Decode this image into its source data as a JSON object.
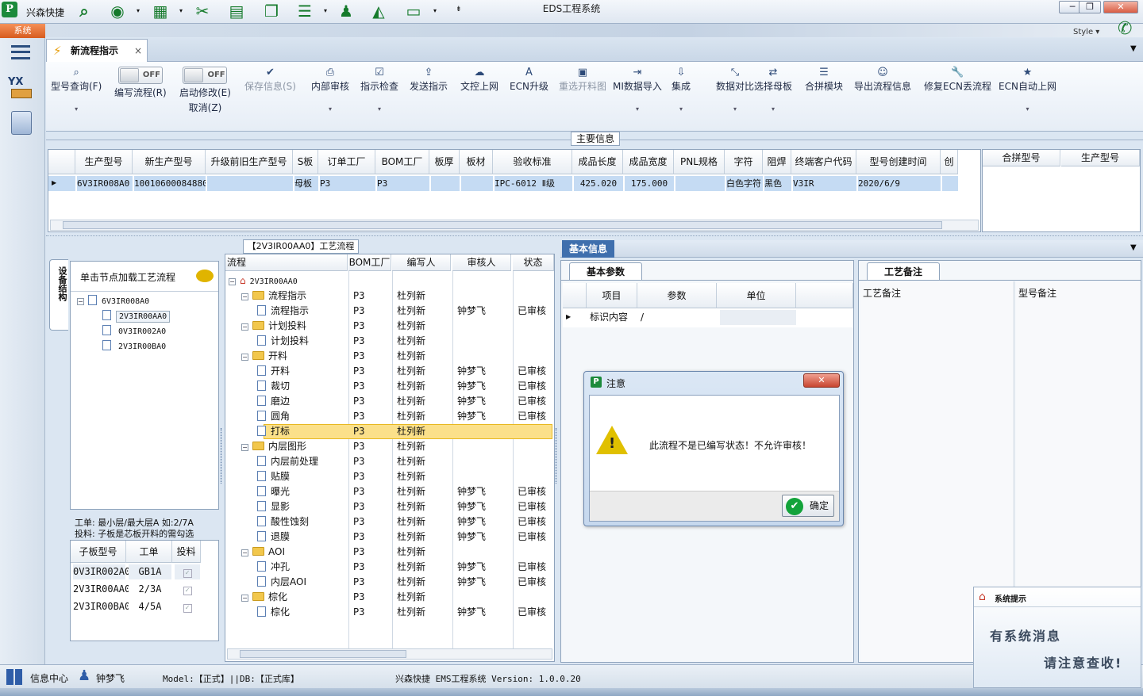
{
  "window": {
    "app_name": "兴森快捷",
    "title": "EDS工程系统",
    "minimize": "─",
    "restore": "❐",
    "close": "✕",
    "style_label": "Style"
  },
  "system_menu": "系统",
  "rail_icons": [
    "menu-icon",
    "yx-factory-icon",
    "calculator-icon"
  ],
  "rail_text": "YX",
  "tab": {
    "label": "新流程指示",
    "close": "×"
  },
  "ribbon": [
    {
      "label": "型号查询(F)",
      "icon": "search-icon",
      "glyph": "⌕",
      "dropdown": true
    },
    {
      "label": "编写流程(R)",
      "toggle": "OFF"
    },
    {
      "label": "启动修改(E)",
      "sub": "取消(Z)",
      "toggle": "OFF"
    },
    {
      "label": "保存信息(S)",
      "icon": "check-icon",
      "glyph": "✔",
      "disabled": true
    },
    {
      "label": "内部审核",
      "icon": "print-icon",
      "glyph": "⎙",
      "dropdown": true
    },
    {
      "label": "指示检查",
      "icon": "checkbox-icon",
      "glyph": "☑",
      "dropdown": true
    },
    {
      "label": "发送指示",
      "icon": "upload-icon",
      "glyph": "⇪"
    },
    {
      "label": "文控上网",
      "icon": "cloud-upload-icon",
      "glyph": "☁"
    },
    {
      "label": "ECN升级",
      "icon": "font-icon",
      "glyph": "A"
    },
    {
      "label": "重选开料图",
      "icon": "picture-icon",
      "glyph": "▣",
      "disabled": true
    },
    {
      "label": "MI数据导入",
      "icon": "import-icon",
      "glyph": "⇥",
      "dropdown": true
    },
    {
      "label": "集成",
      "icon": "download-icon",
      "glyph": "⇩",
      "dropdown": true
    },
    {
      "label": "数据对比",
      "icon": "compress-icon",
      "glyph": "⤡",
      "dropdown": true
    },
    {
      "label": "选择母板",
      "icon": "shuffle-icon",
      "glyph": "⇄",
      "dropdown": true
    },
    {
      "label": "合拼模块",
      "icon": "list-icon",
      "glyph": "☰"
    },
    {
      "label": "导出流程信息",
      "icon": "smile-icon",
      "glyph": "☺"
    },
    {
      "label": "修复ECN丢流程",
      "icon": "wrench-icon",
      "glyph": "🔧"
    },
    {
      "label": "ECN自动上网",
      "icon": "star-icon",
      "glyph": "★",
      "dropdown": true
    }
  ],
  "main_info": {
    "title": "主要信息",
    "columns": [
      "生产型号",
      "新生产型号",
      "升级前旧生产型号",
      "S板",
      "订单工厂",
      "BOM工厂",
      "板厚",
      "板材",
      "验收标准",
      "成品长度",
      "成品宽度",
      "PNL规格",
      "字符",
      "阻焊",
      "终端客户代码",
      "型号创建时间",
      "创"
    ],
    "row": [
      "6V3IR008A0",
      "10010600084880",
      "",
      "母板",
      "P3",
      "P3",
      "",
      "",
      "IPC-6012 Ⅱ级",
      "425.020",
      "175.000",
      "",
      "白色字符",
      "黑色",
      "V3IR",
      "2020/6/9",
      ""
    ],
    "side_columns": [
      "合拼型号",
      "生产型号"
    ]
  },
  "left_panel": {
    "vertical_tab": "设备结构",
    "hint": "单击节点加载工艺流程",
    "tree": {
      "root": "6V3IR008A0",
      "children": [
        "2V3IR00AA0",
        "0V3IR002A0",
        "2V3IR00BA0"
      ],
      "selected": "2V3IR00AA0"
    },
    "note_line1": "工单: 最小层/最大层A 如:2/7A",
    "note_line2": "投料: 子板是芯板开料的需勾选",
    "sub_table": {
      "columns": [
        "子板型号",
        "工单",
        "投料"
      ],
      "rows": [
        [
          "0V3IR002A0",
          "GB1A",
          true
        ],
        [
          "2V3IR00AA0",
          "2/3A",
          true
        ],
        [
          "2V3IR00BA0",
          "4/5A",
          true
        ]
      ]
    }
  },
  "flow_panel": {
    "title": "【2V3IR00AA0】工艺流程",
    "columns": [
      "流程",
      "BOM工厂",
      "编写人",
      "审核人",
      "状态"
    ],
    "root": "2V3IR00AA0",
    "rows": [
      {
        "name": "流程指示",
        "level": 1,
        "bom": "P3",
        "writer": "杜列新",
        "reviewer": "",
        "status": ""
      },
      {
        "name": "流程指示",
        "level": 2,
        "bom": "P3",
        "writer": "杜列新",
        "reviewer": "钟梦飞",
        "status": "已审核"
      },
      {
        "name": "计划投料",
        "level": 1,
        "bom": "P3",
        "writer": "杜列新",
        "reviewer": "",
        "status": ""
      },
      {
        "name": "计划投料",
        "level": 2,
        "bom": "P3",
        "writer": "杜列新",
        "reviewer": "",
        "status": ""
      },
      {
        "name": "开料",
        "level": 1,
        "bom": "P3",
        "writer": "杜列新",
        "reviewer": "",
        "status": ""
      },
      {
        "name": "开料",
        "level": 2,
        "bom": "P3",
        "writer": "杜列新",
        "reviewer": "钟梦飞",
        "status": "已审核"
      },
      {
        "name": "裁切",
        "level": 2,
        "bom": "P3",
        "writer": "杜列新",
        "reviewer": "钟梦飞",
        "status": "已审核"
      },
      {
        "name": "磨边",
        "level": 2,
        "bom": "P3",
        "writer": "杜列新",
        "reviewer": "钟梦飞",
        "status": "已审核"
      },
      {
        "name": "圆角",
        "level": 2,
        "bom": "P3",
        "writer": "杜列新",
        "reviewer": "钟梦飞",
        "status": "已审核"
      },
      {
        "name": "打标",
        "level": 2,
        "bom": "P3",
        "writer": "杜列新",
        "reviewer": "",
        "status": "",
        "selected": true
      },
      {
        "name": "内层图形",
        "level": 1,
        "bom": "P3",
        "writer": "杜列新",
        "reviewer": "",
        "status": ""
      },
      {
        "name": "内层前处理",
        "level": 2,
        "bom": "P3",
        "writer": "杜列新",
        "reviewer": "",
        "status": ""
      },
      {
        "name": "贴膜",
        "level": 2,
        "bom": "P3",
        "writer": "杜列新",
        "reviewer": "",
        "status": ""
      },
      {
        "name": "曝光",
        "level": 2,
        "bom": "P3",
        "writer": "杜列新",
        "reviewer": "钟梦飞",
        "status": "已审核"
      },
      {
        "name": "显影",
        "level": 2,
        "bom": "P3",
        "writer": "杜列新",
        "reviewer": "钟梦飞",
        "status": "已审核"
      },
      {
        "name": "酸性蚀刻",
        "level": 2,
        "bom": "P3",
        "writer": "杜列新",
        "reviewer": "钟梦飞",
        "status": "已审核"
      },
      {
        "name": "退膜",
        "level": 2,
        "bom": "P3",
        "writer": "杜列新",
        "reviewer": "钟梦飞",
        "status": "已审核"
      },
      {
        "name": "AOI",
        "level": 1,
        "bom": "P3",
        "writer": "杜列新",
        "reviewer": "",
        "status": ""
      },
      {
        "name": "冲孔",
        "level": 2,
        "bom": "P3",
        "writer": "杜列新",
        "reviewer": "钟梦飞",
        "status": "已审核"
      },
      {
        "name": "内层AOI",
        "level": 2,
        "bom": "P3",
        "writer": "杜列新",
        "reviewer": "钟梦飞",
        "status": "已审核"
      },
      {
        "name": "棕化",
        "level": 1,
        "bom": "P3",
        "writer": "杜列新",
        "reviewer": "",
        "status": ""
      },
      {
        "name": "棕化",
        "level": 2,
        "bom": "P3",
        "writer": "杜列新",
        "reviewer": "钟梦飞",
        "status": "已审核"
      }
    ]
  },
  "basic_info": {
    "title": "基本信息",
    "tab": "基本参数",
    "columns": [
      "项目",
      "参数",
      "单位"
    ],
    "row": [
      "标识内容",
      "/",
      ""
    ]
  },
  "process_notes": {
    "tab": "工艺备注",
    "columns": [
      "工艺备注",
      "型号备注"
    ]
  },
  "dialog": {
    "title": "注意",
    "message": "此流程不是已编写状态！不允许审核！",
    "ok": "确定",
    "close": "✕"
  },
  "status_bar": {
    "info_center": "信息中心",
    "user": "钟梦飞",
    "model_db": "Model:【正式】||DB:【正式库】",
    "version": "兴森快捷 EMS工程系统 Version: 1.0.0.20"
  },
  "notify": {
    "title": "系统提示",
    "line1": "有系统消息",
    "line2": "请注意查收!"
  }
}
